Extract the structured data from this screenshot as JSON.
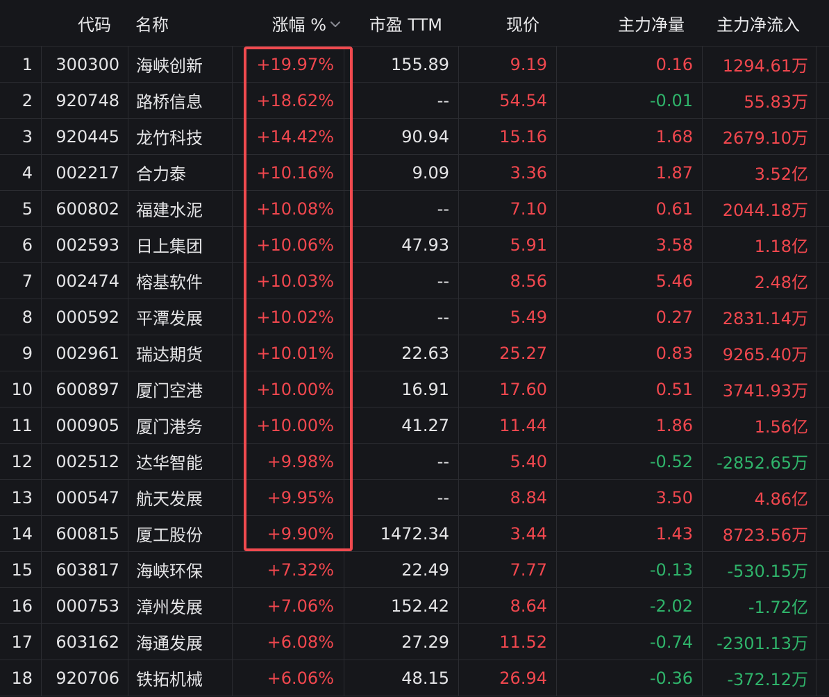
{
  "header": {
    "code": "代码",
    "name": "名称",
    "change": "涨幅 %",
    "pe": "市盈 TTM",
    "price": "现价",
    "net_volume": "主力净量",
    "net_inflow": "主力净流入",
    "sort_icon": "chevron-down-icon"
  },
  "colors": {
    "background": "#16171b",
    "up": "#f0474e",
    "down": "#2fb36a",
    "highlight": "#f04a4f"
  },
  "rows": [
    {
      "idx": "1",
      "code": "300300",
      "name": "海峡创新",
      "change": "+19.97%",
      "pe": "155.89",
      "price": "9.19",
      "net_volume": "0.16",
      "net_inflow": "1294.61万",
      "vol_dir": "up",
      "flow_dir": "up"
    },
    {
      "idx": "2",
      "code": "920748",
      "name": "路桥信息",
      "change": "+18.62%",
      "pe": "--",
      "price": "54.54",
      "net_volume": "-0.01",
      "net_inflow": "55.83万",
      "vol_dir": "down",
      "flow_dir": "up"
    },
    {
      "idx": "3",
      "code": "920445",
      "name": "龙竹科技",
      "change": "+14.42%",
      "pe": "90.94",
      "price": "15.16",
      "net_volume": "1.68",
      "net_inflow": "2679.10万",
      "vol_dir": "up",
      "flow_dir": "up"
    },
    {
      "idx": "4",
      "code": "002217",
      "name": "合力泰",
      "change": "+10.16%",
      "pe": "9.09",
      "price": "3.36",
      "net_volume": "1.87",
      "net_inflow": "3.52亿",
      "vol_dir": "up",
      "flow_dir": "up"
    },
    {
      "idx": "5",
      "code": "600802",
      "name": "福建水泥",
      "change": "+10.08%",
      "pe": "--",
      "price": "7.10",
      "net_volume": "0.61",
      "net_inflow": "2044.18万",
      "vol_dir": "up",
      "flow_dir": "up"
    },
    {
      "idx": "6",
      "code": "002593",
      "name": "日上集团",
      "change": "+10.06%",
      "pe": "47.93",
      "price": "5.91",
      "net_volume": "3.58",
      "net_inflow": "1.18亿",
      "vol_dir": "up",
      "flow_dir": "up"
    },
    {
      "idx": "7",
      "code": "002474",
      "name": "榕基软件",
      "change": "+10.03%",
      "pe": "--",
      "price": "8.56",
      "net_volume": "5.46",
      "net_inflow": "2.48亿",
      "vol_dir": "up",
      "flow_dir": "up"
    },
    {
      "idx": "8",
      "code": "000592",
      "name": "平潭发展",
      "change": "+10.02%",
      "pe": "--",
      "price": "5.49",
      "net_volume": "0.27",
      "net_inflow": "2831.14万",
      "vol_dir": "up",
      "flow_dir": "up"
    },
    {
      "idx": "9",
      "code": "002961",
      "name": "瑞达期货",
      "change": "+10.01%",
      "pe": "22.63",
      "price": "25.27",
      "net_volume": "0.83",
      "net_inflow": "9265.40万",
      "vol_dir": "up",
      "flow_dir": "up"
    },
    {
      "idx": "10",
      "code": "600897",
      "name": "厦门空港",
      "change": "+10.00%",
      "pe": "16.91",
      "price": "17.60",
      "net_volume": "0.51",
      "net_inflow": "3741.93万",
      "vol_dir": "up",
      "flow_dir": "up"
    },
    {
      "idx": "11",
      "code": "000905",
      "name": "厦门港务",
      "change": "+10.00%",
      "pe": "41.27",
      "price": "11.44",
      "net_volume": "1.86",
      "net_inflow": "1.56亿",
      "vol_dir": "up",
      "flow_dir": "up"
    },
    {
      "idx": "12",
      "code": "002512",
      "name": "达华智能",
      "change": "+9.98%",
      "pe": "--",
      "price": "5.40",
      "net_volume": "-0.52",
      "net_inflow": "-2852.65万",
      "vol_dir": "down",
      "flow_dir": "down"
    },
    {
      "idx": "13",
      "code": "000547",
      "name": "航天发展",
      "change": "+9.95%",
      "pe": "--",
      "price": "8.84",
      "net_volume": "3.50",
      "net_inflow": "4.86亿",
      "vol_dir": "up",
      "flow_dir": "up"
    },
    {
      "idx": "14",
      "code": "600815",
      "name": "厦工股份",
      "change": "+9.90%",
      "pe": "1472.34",
      "price": "3.44",
      "net_volume": "1.43",
      "net_inflow": "8723.56万",
      "vol_dir": "up",
      "flow_dir": "up"
    },
    {
      "idx": "15",
      "code": "603817",
      "name": "海峡环保",
      "change": "+7.32%",
      "pe": "22.49",
      "price": "7.77",
      "net_volume": "-0.13",
      "net_inflow": "-530.15万",
      "vol_dir": "down",
      "flow_dir": "down"
    },
    {
      "idx": "16",
      "code": "000753",
      "name": "漳州发展",
      "change": "+7.06%",
      "pe": "152.42",
      "price": "8.64",
      "net_volume": "-2.02",
      "net_inflow": "-1.72亿",
      "vol_dir": "down",
      "flow_dir": "down"
    },
    {
      "idx": "17",
      "code": "603162",
      "name": "海通发展",
      "change": "+6.08%",
      "pe": "27.29",
      "price": "11.52",
      "net_volume": "-0.74",
      "net_inflow": "-2301.13万",
      "vol_dir": "down",
      "flow_dir": "down"
    },
    {
      "idx": "18",
      "code": "920706",
      "name": "铁拓机械",
      "change": "+6.06%",
      "pe": "48.15",
      "price": "26.94",
      "net_volume": "-0.36",
      "net_inflow": "-372.12万",
      "vol_dir": "down",
      "flow_dir": "down"
    }
  ]
}
